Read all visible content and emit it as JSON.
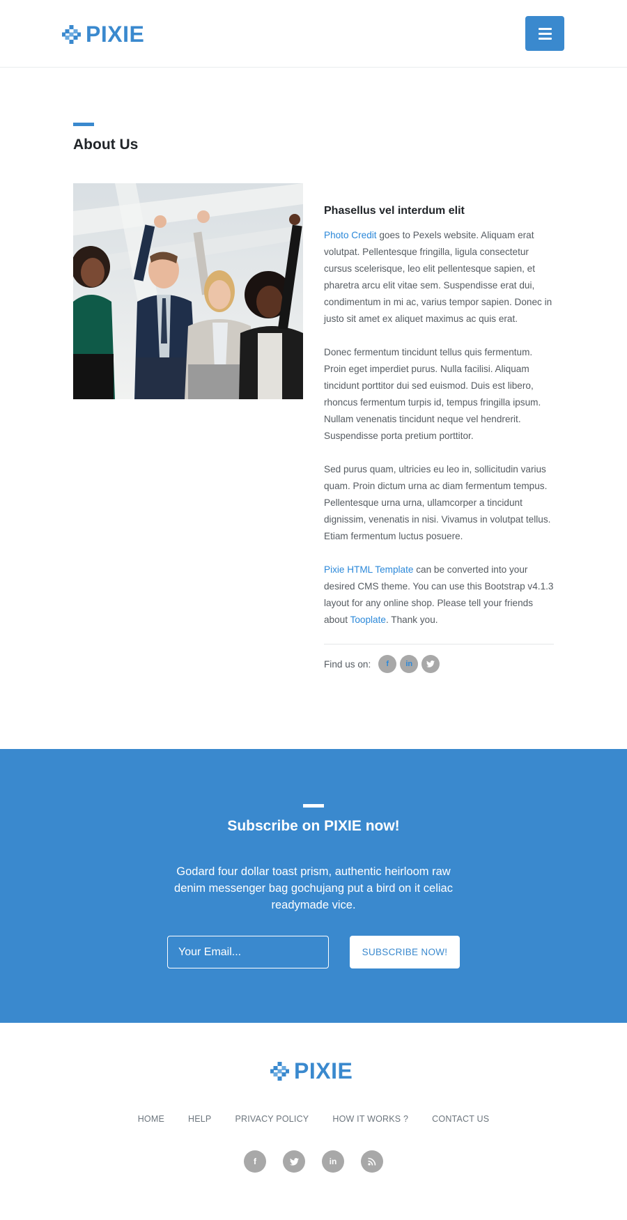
{
  "brand": {
    "name": "PIXIE",
    "color": "#3a89ce",
    "logo_icon": "pixel-diamond-icon"
  },
  "header": {
    "menu_icon": "hamburger-menu-icon"
  },
  "about": {
    "title": "About Us",
    "photo_alt": "team-celebrating-photo",
    "heading": "Phasellus vel interdum elit",
    "p1_link": "Photo Credit",
    "p1_text": " goes to Pexels website. Aliquam erat volutpat. Pellentesque fringilla, ligula consectetur cursus scelerisque, leo elit pellentesque sapien, et pharetra arcu elit vitae sem. Suspendisse erat dui, condimentum in mi ac, varius tempor sapien. Donec in justo sit amet ex aliquet maximus ac quis erat.",
    "p2": "Donec fermentum tincidunt tellus quis fermentum. Proin eget imperdiet purus. Nulla facilisi. Aliquam tincidunt porttitor dui sed euismod. Duis est libero, rhoncus fermentum turpis id, tempus fringilla ipsum. Nullam venenatis tincidunt neque vel hendrerit. Suspendisse porta pretium porttitor.",
    "p3": "Sed purus quam, ultricies eu leo in, sollicitudin varius quam. Proin dictum urna ac diam fermentum tempus. Pellentesque urna urna, ullamcorper a tincidunt dignissim, venenatis in nisi. Vivamus in volutpat tellus. Etiam fermentum luctus posuere.",
    "p4_link1": "Pixie HTML Template",
    "p4_text1": " can be converted into your desired CMS theme. You can use this Bootstrap v4.1.3 layout for any online shop. Please tell your friends about ",
    "p4_link2": "Tooplate",
    "p4_text2": ". Thank you.",
    "find_us_label": "Find us on:",
    "social": [
      {
        "icon": "facebook-icon",
        "glyph": "f"
      },
      {
        "icon": "linkedin-icon",
        "glyph": "in"
      },
      {
        "icon": "twitter-icon",
        "glyph": "🐦"
      }
    ]
  },
  "subscribe": {
    "bg_color": "#3a89ce",
    "title": "Subscribe on PIXIE now!",
    "text": "Godard four dollar toast prism, authentic heirloom raw denim messenger bag gochujang put a bird on it celiac readymade vice.",
    "email_placeholder": "Your Email...",
    "button_label": "SUBSCRIBE NOW!"
  },
  "footer": {
    "nav": [
      "HOME",
      "HELP",
      "PRIVACY POLICY",
      "HOW IT WORKS ?",
      "CONTACT US"
    ],
    "social": [
      {
        "icon": "facebook-icon",
        "glyph": "f"
      },
      {
        "icon": "twitter-icon",
        "glyph": "🐦"
      },
      {
        "icon": "linkedin-icon",
        "glyph": "in"
      },
      {
        "icon": "rss-icon",
        "glyph": "◉"
      }
    ]
  }
}
